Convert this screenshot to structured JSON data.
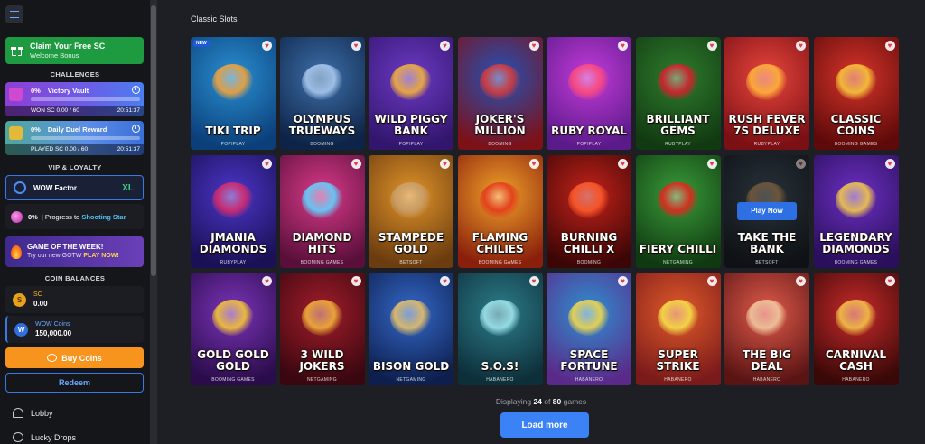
{
  "sidebar": {
    "claim": {
      "title": "Claim Your Free SC",
      "subtitle": "Welcome Bonus"
    },
    "challenges_title": "CHALLENGES",
    "challenges": [
      {
        "percent": "0%",
        "name": "Victory Vault",
        "progress": "WON SC 0.00 / 60",
        "time": "20:51:37",
        "fraction": 0
      },
      {
        "percent": "0%",
        "name": "Daily Duel Reward",
        "progress": "PLAYED SC 0.00 / 60",
        "time": "20:51:37",
        "fraction": 0
      }
    ],
    "vip_title": "VIP & LOYALTY",
    "wow_factor": {
      "label": "WOW Factor",
      "level": "XL"
    },
    "progress": {
      "percent": "0%",
      "text": "| Progress to",
      "target": "Shooting Star"
    },
    "gotw": {
      "title": "GAME OF THE WEEK!",
      "text": "Try our new GOTW",
      "cta": "PLAY NOW!"
    },
    "balances_title": "COIN BALANCES",
    "coins": [
      {
        "name": "SC",
        "value": "0.00",
        "icon": "S"
      },
      {
        "name": "WOW Coins",
        "value": "150,000.00",
        "icon": "W"
      }
    ],
    "buy_label": "Buy Coins",
    "redeem_label": "Redeem",
    "nav": [
      {
        "label": "Lobby",
        "icon": "home-icon"
      },
      {
        "label": "Lucky Drops",
        "icon": "gift-drop-icon"
      }
    ]
  },
  "main": {
    "title": "Classic Slots",
    "tiles": [
      {
        "name": "Tiki Trip",
        "provider": "POPIPLAY",
        "badge": "NEW",
        "bg1": "#2a8fd1",
        "bg2": "#0b3f7a",
        "accent": "#f2a33a"
      },
      {
        "name": "Olympus Trueways",
        "provider": "BOOMING",
        "bg1": "#3d6fa8",
        "bg2": "#0d2347",
        "accent": "#a9c8ee"
      },
      {
        "name": "Wild Piggy Bank",
        "provider": "POPIPLAY",
        "bg1": "#6d39c4",
        "bg2": "#32166d",
        "accent": "#f4b23a"
      },
      {
        "name": "Joker's Million",
        "provider": "BOOMING",
        "bg1": "#2352b8",
        "bg2": "#7c1118",
        "accent": "#d63b3b"
      },
      {
        "name": "Ruby Royal",
        "provider": "POPIPLAY",
        "bg1": "#c23bd8",
        "bg2": "#5b1a8a",
        "accent": "#ff4a7a"
      },
      {
        "name": "Brilliant Gems",
        "provider": "RUBYPLAY",
        "bg1": "#2e7c2c",
        "bg2": "#123a12",
        "accent": "#d61f2d"
      },
      {
        "name": "Rush Fever 7s Deluxe",
        "provider": "RUBYPLAY",
        "bg1": "#e8453c",
        "bg2": "#7a0f14",
        "accent": "#ffb43a"
      },
      {
        "name": "Classic Coins",
        "provider": "BOOMING GAMES",
        "bg1": "#d6342a",
        "bg2": "#5e0a0a",
        "accent": "#f8c63b"
      },
      {
        "name": "Jmania Diamonds",
        "provider": "RUBYPLAY",
        "bg1": "#4b35c8",
        "bg2": "#1a1055",
        "accent": "#d72b6c"
      },
      {
        "name": "Diamond Hits",
        "provider": "BOOMING GAMES",
        "bg1": "#d83a8a",
        "bg2": "#5a0f3a",
        "accent": "#5fd3ff"
      },
      {
        "name": "Stampede Gold",
        "provider": "BETSOFT",
        "bg1": "#e0932a",
        "bg2": "#6b3c0f",
        "accent": "#c9a06a"
      },
      {
        "name": "Flaming Chilies",
        "provider": "BOOMING GAMES",
        "bg1": "#f0a12a",
        "bg2": "#8a1f0c",
        "accent": "#e53a1a"
      },
      {
        "name": "Burning Chilli X",
        "provider": "BOOMING",
        "bg1": "#c4221a",
        "bg2": "#3c0606",
        "accent": "#ff5a2a"
      },
      {
        "name": "Fiery Chilli",
        "provider": "NETGAMING",
        "bg1": "#3a9b3a",
        "bg2": "#0f3a10",
        "accent": "#e2261c"
      },
      {
        "name": "Take the Bank",
        "provider": "BETSOFT",
        "bg1": "#4a5a68",
        "bg2": "#1a2128",
        "accent": "#d2a36b",
        "hover": "Play Now"
      },
      {
        "name": "Legendary Diamonds",
        "provider": "BOOMING GAMES",
        "bg1": "#6b2fc0",
        "bg2": "#2a0f5c",
        "accent": "#f2c94c"
      },
      {
        "name": "Gold Gold Gold",
        "provider": "BOOMING GAMES",
        "bg1": "#7a33b8",
        "bg2": "#2a0c4a",
        "accent": "#f7c734"
      },
      {
        "name": "3 Wild Jokers",
        "provider": "NETGAMING",
        "bg1": "#a11d2a",
        "bg2": "#3a0710",
        "accent": "#f3b13a"
      },
      {
        "name": "Bison Gold",
        "provider": "NETGAMING",
        "bg1": "#3468c8",
        "bg2": "#0d1f4e",
        "accent": "#e8c168"
      },
      {
        "name": "S.O.S!",
        "provider": "HABANERO",
        "bg1": "#2c7d8a",
        "bg2": "#0d2f3a",
        "accent": "#a0e6ee"
      },
      {
        "name": "Space Fortune",
        "provider": "HABANERO",
        "bg1": "#2f8fd0",
        "bg2": "#5a2a8a",
        "accent": "#f3d84a"
      },
      {
        "name": "Super Strike",
        "provider": "HABANERO",
        "bg1": "#e05a2a",
        "bg2": "#7a1a1a",
        "accent": "#f7e14a"
      },
      {
        "name": "The Big Deal",
        "provider": "HABANERO",
        "bg1": "#e05a4a",
        "bg2": "#5a1414",
        "accent": "#f1c9a0"
      },
      {
        "name": "Carnival Cash",
        "provider": "HABANERO",
        "bg1": "#c82a2a",
        "bg2": "#3a0808",
        "accent": "#f6c24a"
      }
    ],
    "displaying_prefix": "Displaying",
    "displaying_count": "24",
    "displaying_of": "of",
    "displaying_total": "80",
    "displaying_suffix": "games",
    "load_more": "Load more"
  }
}
